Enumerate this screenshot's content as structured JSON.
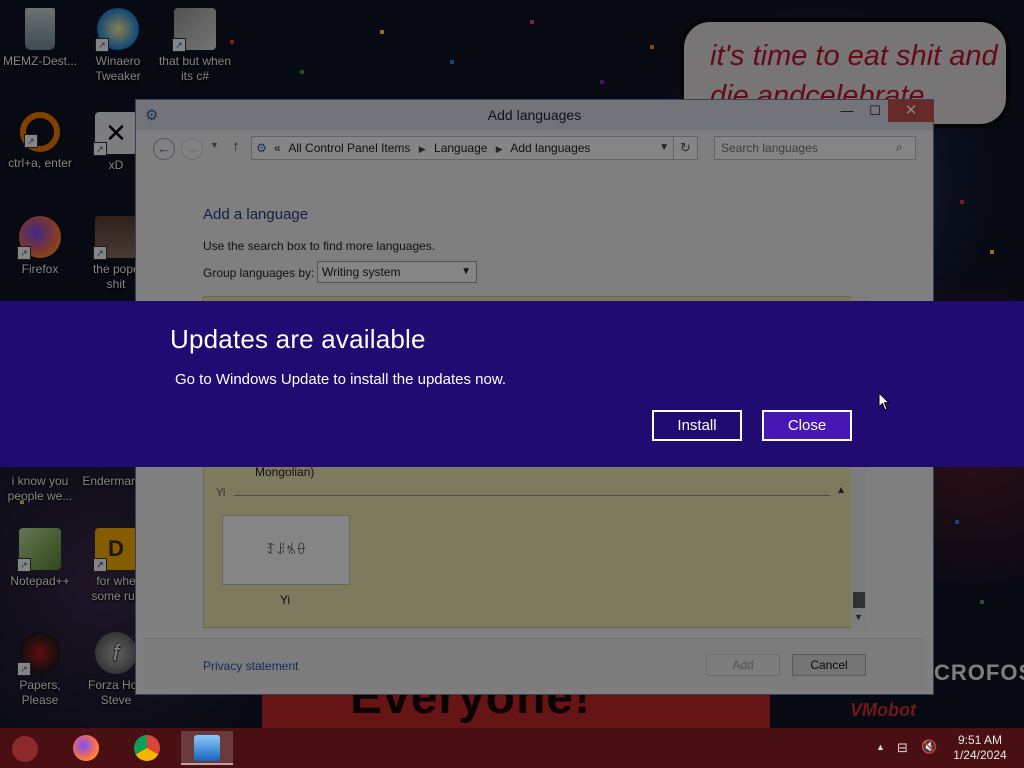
{
  "desktop": {
    "icons": [
      {
        "label": "MEMZ-Dest..."
      },
      {
        "label": "Winaero\nTweaker"
      },
      {
        "label": "that but when\nits c#"
      },
      {
        "label": "ctrl+a, enter"
      },
      {
        "label": "xD"
      },
      {
        "label": "Firefox"
      },
      {
        "label": "the popc\nshit"
      },
      {
        "label": "i know you\npeople we..."
      },
      {
        "label": "Enderman"
      },
      {
        "label": "Notepad++"
      },
      {
        "label": "for whe\nsome rus"
      },
      {
        "label": "Papers, Please"
      },
      {
        "label": "Forza Hori\nSteve"
      }
    ],
    "wallpaper": {
      "speech_bubble": "it's time to eat shit and die andcelebrate",
      "poster_text": "Everyone!",
      "right_text": "CROFOS",
      "logo_text": "VMobot"
    }
  },
  "window": {
    "title": "Add languages",
    "controls": {
      "minimize": "—",
      "maximize": "☐",
      "close": "✕"
    },
    "breadcrumb": {
      "prefix": "«",
      "items": [
        "All Control Panel Items",
        "Language",
        "Add languages"
      ]
    },
    "search_placeholder": "Search languages",
    "heading": "Add a language",
    "description": "Use the search box to find more languages.",
    "group_by_label": "Group languages by:",
    "group_by_value": "Writing system",
    "list": {
      "partial_item": "Mongolian)",
      "group_name": "Yi",
      "tile_script": "ꆈꌠꁱꂷ",
      "tile_label": "Yi"
    },
    "footer": {
      "privacy": "Privacy statement",
      "add": "Add",
      "cancel": "Cancel"
    }
  },
  "notification": {
    "title": "Updates are available",
    "message": "Go to Windows Update to install the updates now.",
    "install": "Install",
    "close": "Close",
    "background": "#1f0b72"
  },
  "taskbar": {
    "time": "9:51 AM",
    "date": "1/24/2024",
    "apps": [
      "Firefox",
      "Google Chrome",
      "Control Panel"
    ]
  }
}
